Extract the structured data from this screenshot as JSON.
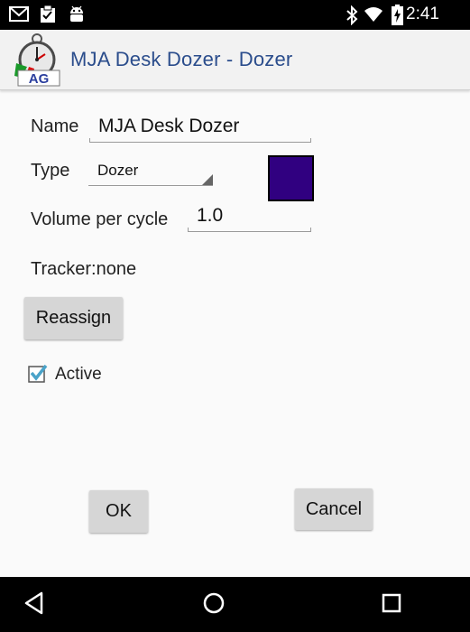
{
  "status_bar": {
    "time": "2:41",
    "left_icons": [
      "gmail-icon",
      "clipboard-icon",
      "android-icon"
    ],
    "right_icons": [
      "bluetooth-icon",
      "wifi-icon",
      "battery-charging-icon"
    ]
  },
  "action_bar": {
    "title": "MJA Desk Dozer - Dozer",
    "logo_text": "AG",
    "title_color": "#2b4d8c"
  },
  "form": {
    "name_label": "Name",
    "name_value": "MJA Desk Dozer",
    "type_label": "Type",
    "type_value": "Dozer",
    "color_value": "#300080",
    "volume_label": "Volume per cycle",
    "volume_value": "1.0",
    "tracker_text": "Tracker:none",
    "reassign_label": "Reassign",
    "active_label": "Active",
    "active_checked": true,
    "checkbox_color": "#4aa3c9"
  },
  "dialog_buttons": {
    "ok_label": "OK",
    "cancel_label": "Cancel"
  },
  "nav_bar": {
    "icons": [
      "back-icon",
      "home-icon",
      "recents-icon"
    ]
  }
}
